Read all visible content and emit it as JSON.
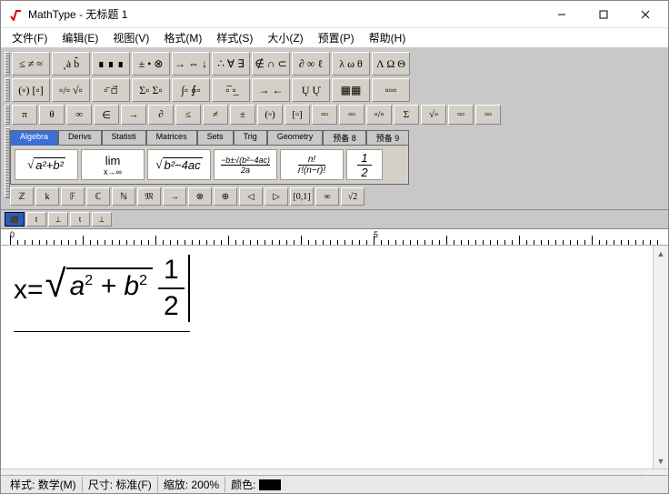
{
  "window": {
    "title": "MathType - 无标题 1"
  },
  "menu": {
    "file": "文件(F)",
    "edit": "编辑(E)",
    "view": "视图(V)",
    "format": "格式(M)",
    "style": "样式(S)",
    "size": "大小(Z)",
    "prefs": "预置(P)",
    "help": "帮助(H)"
  },
  "symbol_rows": {
    "r1": [
      "≤ ≠ ≈",
      "¸ȧ b̂",
      "∎ ∎ ∎",
      "± • ⊗",
      "→ ⇔ ↓",
      "∴ ∀ ∃",
      "∉ ∩ ⊂",
      "∂ ∞ ℓ",
      "λ ω θ",
      "Λ Ω Θ"
    ],
    "r2": [
      "(▫) [▫]",
      "▫/▫ √▫",
      "▫̄ ▫⃗",
      "Σ▫ Σ▫",
      "∫▫ ∮▫",
      "▫̅ ▫̲",
      "→ ←",
      "Ų Ų̇",
      "▦▦",
      "▫▫▫"
    ],
    "r3": [
      "π",
      "θ",
      "∞",
      "∈",
      "→",
      "∂",
      "≤",
      "≠",
      "±",
      "(▫)",
      "[▫]",
      "▫▫",
      "▫▫",
      "▫/▫",
      "Σ",
      "√▫",
      "▫▫",
      "▫▫"
    ]
  },
  "tabs": [
    "Algebra",
    "Derivs",
    "Statisti",
    "Matrices",
    "Sets",
    "Trig",
    "Geometry",
    "预备 8",
    "预备 9"
  ],
  "active_tab": 0,
  "templates": {
    "t1": "√(a²+b²)",
    "t2": "lim x→∞",
    "t3": "√(b²−4ac)",
    "t4": "(−b±√(b²−4ac))/2a",
    "t5": "n! / r!(n−r)!",
    "t6": "1/2"
  },
  "mini_row": [
    "ℤ",
    "k",
    "𝔽",
    "ℂ",
    "ℕ",
    "𝔐",
    "→",
    "⊗",
    "⊕",
    "◁",
    "▷",
    "[0,1]",
    "∞",
    "√2"
  ],
  "small_tabs": [
    "⬛",
    "t",
    "⊥",
    "t",
    "⊥"
  ],
  "ruler": {
    "start": 0,
    "marks": [
      "0",
      "5"
    ]
  },
  "formula": {
    "lhs": "x=",
    "radicand_a": "a",
    "radicand_b": "b",
    "frac_num": "1",
    "frac_den": "2"
  },
  "status": {
    "style_label": "样式:",
    "style_value": "数学(M)",
    "size_label": "尺寸:",
    "size_value": "标准(F)",
    "zoom_label": "缩放:",
    "zoom_value": "200%",
    "color_label": "颜色:"
  }
}
